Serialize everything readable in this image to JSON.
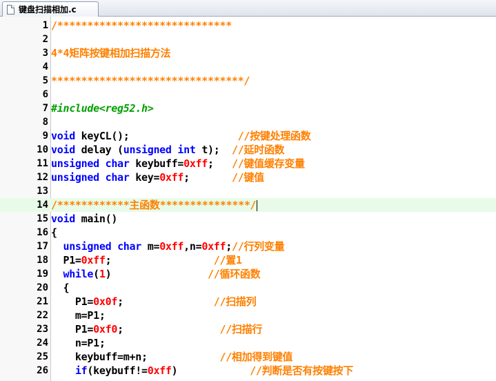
{
  "tab": {
    "label": "键盘扫描相加.c",
    "icon": "file-icon"
  },
  "colors": {
    "keyword": "#0000ff",
    "number": "#ff0000",
    "comment": "#ff8000",
    "preprocessor": "#00a000",
    "current_line": "#e8fbe8"
  },
  "current_line": 14,
  "lines": [
    {
      "n": "1",
      "tokens": [
        {
          "t": "/*****************************",
          "c": "cmt"
        }
      ]
    },
    {
      "n": "2",
      "tokens": []
    },
    {
      "n": "3",
      "tokens": [
        {
          "t": "4*4矩阵按键相加扫描方法",
          "c": "cmt"
        }
      ]
    },
    {
      "n": "4",
      "tokens": []
    },
    {
      "n": "5",
      "tokens": [
        {
          "t": "********************************/",
          "c": "cmt"
        }
      ]
    },
    {
      "n": "6",
      "tokens": []
    },
    {
      "n": "7",
      "tokens": [
        {
          "t": "#include<reg52.h>",
          "c": "pre"
        }
      ]
    },
    {
      "n": "8",
      "tokens": []
    },
    {
      "n": "9",
      "tokens": [
        {
          "t": "void",
          "c": "kw"
        },
        {
          "t": " keyCL();                  ",
          "c": ""
        },
        {
          "t": "//按键处理函数",
          "c": "cmt"
        }
      ]
    },
    {
      "n": "10",
      "tokens": [
        {
          "t": "void",
          "c": "kw"
        },
        {
          "t": " delay (",
          "c": ""
        },
        {
          "t": "unsigned",
          "c": "kw"
        },
        {
          "t": " ",
          "c": ""
        },
        {
          "t": "int",
          "c": "kw"
        },
        {
          "t": " t);  ",
          "c": ""
        },
        {
          "t": "//延时函数",
          "c": "cmt"
        }
      ]
    },
    {
      "n": "11",
      "tokens": [
        {
          "t": "unsigned",
          "c": "kw"
        },
        {
          "t": " ",
          "c": ""
        },
        {
          "t": "char",
          "c": "kw"
        },
        {
          "t": " keybuff=",
          "c": ""
        },
        {
          "t": "0xff",
          "c": "num"
        },
        {
          "t": ";   ",
          "c": ""
        },
        {
          "t": "//键值缓存变量",
          "c": "cmt"
        }
      ]
    },
    {
      "n": "12",
      "tokens": [
        {
          "t": "unsigned",
          "c": "kw"
        },
        {
          "t": " ",
          "c": ""
        },
        {
          "t": "char",
          "c": "kw"
        },
        {
          "t": " key=",
          "c": ""
        },
        {
          "t": "0xff",
          "c": "num"
        },
        {
          "t": ";       ",
          "c": ""
        },
        {
          "t": "//键值",
          "c": "cmt"
        }
      ]
    },
    {
      "n": "13",
      "tokens": []
    },
    {
      "n": "14",
      "tokens": [
        {
          "t": "/************主函数***************/",
          "c": "cmt"
        }
      ]
    },
    {
      "n": "15",
      "tokens": [
        {
          "t": "void",
          "c": "kw"
        },
        {
          "t": " main()",
          "c": ""
        }
      ]
    },
    {
      "n": "16",
      "tokens": [
        {
          "t": "{",
          "c": ""
        }
      ]
    },
    {
      "n": "17",
      "tokens": [
        {
          "t": "  ",
          "c": ""
        },
        {
          "t": "unsigned",
          "c": "kw"
        },
        {
          "t": " ",
          "c": ""
        },
        {
          "t": "char",
          "c": "kw"
        },
        {
          "t": " m=",
          "c": ""
        },
        {
          "t": "0xff",
          "c": "num"
        },
        {
          "t": ",n=",
          "c": ""
        },
        {
          "t": "0xff",
          "c": "num"
        },
        {
          "t": ";",
          "c": ""
        },
        {
          "t": "//行列变量",
          "c": "cmt"
        }
      ]
    },
    {
      "n": "18",
      "tokens": [
        {
          "t": "  P1=",
          "c": ""
        },
        {
          "t": "0xff",
          "c": "num"
        },
        {
          "t": ";                 ",
          "c": ""
        },
        {
          "t": "//置1",
          "c": "cmt"
        }
      ]
    },
    {
      "n": "19",
      "tokens": [
        {
          "t": "  ",
          "c": ""
        },
        {
          "t": "while",
          "c": "kw"
        },
        {
          "t": "(",
          "c": ""
        },
        {
          "t": "1",
          "c": "num"
        },
        {
          "t": ")                ",
          "c": ""
        },
        {
          "t": "//循环函数",
          "c": "cmt"
        }
      ]
    },
    {
      "n": "20",
      "tokens": [
        {
          "t": "  {",
          "c": ""
        }
      ]
    },
    {
      "n": "21",
      "tokens": [
        {
          "t": "    P1=",
          "c": ""
        },
        {
          "t": "0x0f",
          "c": "num"
        },
        {
          "t": ";               ",
          "c": ""
        },
        {
          "t": "//扫描列",
          "c": "cmt"
        }
      ]
    },
    {
      "n": "22",
      "tokens": [
        {
          "t": "    m=P1;",
          "c": ""
        }
      ]
    },
    {
      "n": "23",
      "tokens": [
        {
          "t": "    P1=",
          "c": ""
        },
        {
          "t": "0xf0",
          "c": "num"
        },
        {
          "t": ";                ",
          "c": ""
        },
        {
          "t": "//扫描行",
          "c": "cmt"
        }
      ]
    },
    {
      "n": "24",
      "tokens": [
        {
          "t": "    n=P1;",
          "c": ""
        }
      ]
    },
    {
      "n": "25",
      "tokens": [
        {
          "t": "    keybuff=m+n;            ",
          "c": ""
        },
        {
          "t": "//相加得到键值",
          "c": "cmt"
        }
      ]
    },
    {
      "n": "26",
      "tokens": [
        {
          "t": "    ",
          "c": ""
        },
        {
          "t": "if",
          "c": "kw"
        },
        {
          "t": "(keybuff!=",
          "c": ""
        },
        {
          "t": "0xff",
          "c": "num"
        },
        {
          "t": ")            ",
          "c": ""
        },
        {
          "t": "//判断是否有按键按下",
          "c": "cmt"
        }
      ]
    }
  ]
}
